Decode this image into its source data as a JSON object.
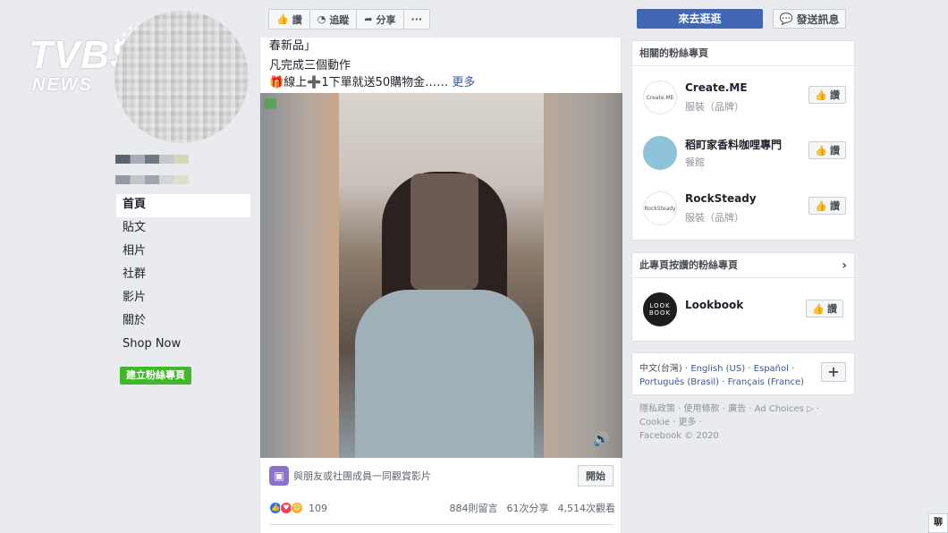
{
  "watermark": {
    "brand": "TVBS",
    "sub": "NEWS"
  },
  "left_nav": {
    "items": [
      {
        "label": "首頁",
        "active": true
      },
      {
        "label": "貼文"
      },
      {
        "label": "相片"
      },
      {
        "label": "社群"
      },
      {
        "label": "影片"
      },
      {
        "label": "關於"
      },
      {
        "label": "Shop Now"
      }
    ],
    "create_page_label": "建立粉絲專頁"
  },
  "toolbar": {
    "like_label": "讚",
    "follow_label": "追蹤",
    "share_label": "分享",
    "more_label": "···"
  },
  "post": {
    "line1": "春新品」",
    "line2": "凡完成三個動作",
    "line3": "線上➕1下單就送50購物金……",
    "more_label": "更多",
    "watch_party_text": "與朋友或社團成員一同觀賞影片",
    "watch_party_button": "開始",
    "reaction_count": "109",
    "comments": "884則留言",
    "shares": "61次分享",
    "views": "4,514次觀看"
  },
  "header_actions": {
    "visit_label": "來去逛逛",
    "message_label": "發送訊息"
  },
  "related_pages": {
    "title": "相關的粉絲專頁",
    "like_label": "讚",
    "pages": [
      {
        "name": "Create.ME",
        "category": "服裝（品牌）",
        "avatar_text": "Create.ME"
      },
      {
        "name": "稻町家香料咖哩專門",
        "category": "餐館",
        "avatar_text": ""
      },
      {
        "name": "RockSteady",
        "category": "服裝（品牌）",
        "avatar_text": "RockSteady"
      }
    ]
  },
  "liked_pages": {
    "title": "此專頁按讚的粉絲專頁",
    "like_label": "讚",
    "pages": [
      {
        "name": "Lookbook",
        "avatar_text": "LOOK BOOK"
      }
    ]
  },
  "languages": {
    "current": "中文(台灣)",
    "others": [
      "English (US)",
      "Español",
      "Português (Brasil)",
      "Français (France)"
    ],
    "plus_label": "+"
  },
  "footer": {
    "line1": "隱私政策 · 使用條款 · 廣告 · Ad Choices ▷ ·",
    "line2": "Cookie · 更多 ·",
    "line3": "Facebook © 2020"
  },
  "chat_tab_label": "聊"
}
